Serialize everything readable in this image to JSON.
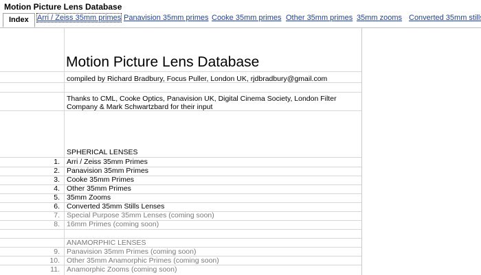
{
  "document_title": "Motion Picture Lens Database",
  "tabs": [
    {
      "label": "Index"
    },
    {
      "label": "Arri / Zeiss 35mm primes"
    },
    {
      "label": "Panavision 35mm primes"
    },
    {
      "label": "Cooke 35mm primes"
    },
    {
      "label": "Other 35mm primes"
    },
    {
      "label": "35mm zooms"
    },
    {
      "label": "Converted 35mm stills"
    }
  ],
  "sheet": {
    "title": "Motion Picture Lens Database",
    "compiled_by": "compiled by Richard Bradbury, Focus Puller, London UK, rjdbradbury@gmail.com",
    "thanks": "Thanks to CML, Cooke Optics, Panavision UK, Digital Cinema Society, London Filter Company & Mark Schwartzbard for their input",
    "spherical_header": "SPHERICAL LENSES",
    "spherical_items": [
      {
        "num": "1.",
        "label": "Arri / Zeiss 35mm Primes"
      },
      {
        "num": "2.",
        "label": "Panavision 35mm Primes"
      },
      {
        "num": "3.",
        "label": "Cooke 35mm Primes"
      },
      {
        "num": "4.",
        "label": "Other 35mm Primes"
      },
      {
        "num": "5.",
        "label": "35mm Zooms"
      },
      {
        "num": "6.",
        "label": "Converted 35mm Stills Lenses"
      },
      {
        "num": "7.",
        "label": "Special Purpose 35mm Lenses (coming soon)"
      },
      {
        "num": "8.",
        "label": "16mm Primes (coming soon)"
      }
    ],
    "anamorphic_header": "ANAMORPHIC LENSES",
    "anamorphic_items": [
      {
        "num": "9.",
        "label": "Panavision 35mm Primes (coming soon)"
      },
      {
        "num": "10.",
        "label": "Other 35mm Anamorphic Primes (coming soon)"
      },
      {
        "num": "11.",
        "label": "Anamorphic Zooms (coming soon)"
      }
    ]
  }
}
